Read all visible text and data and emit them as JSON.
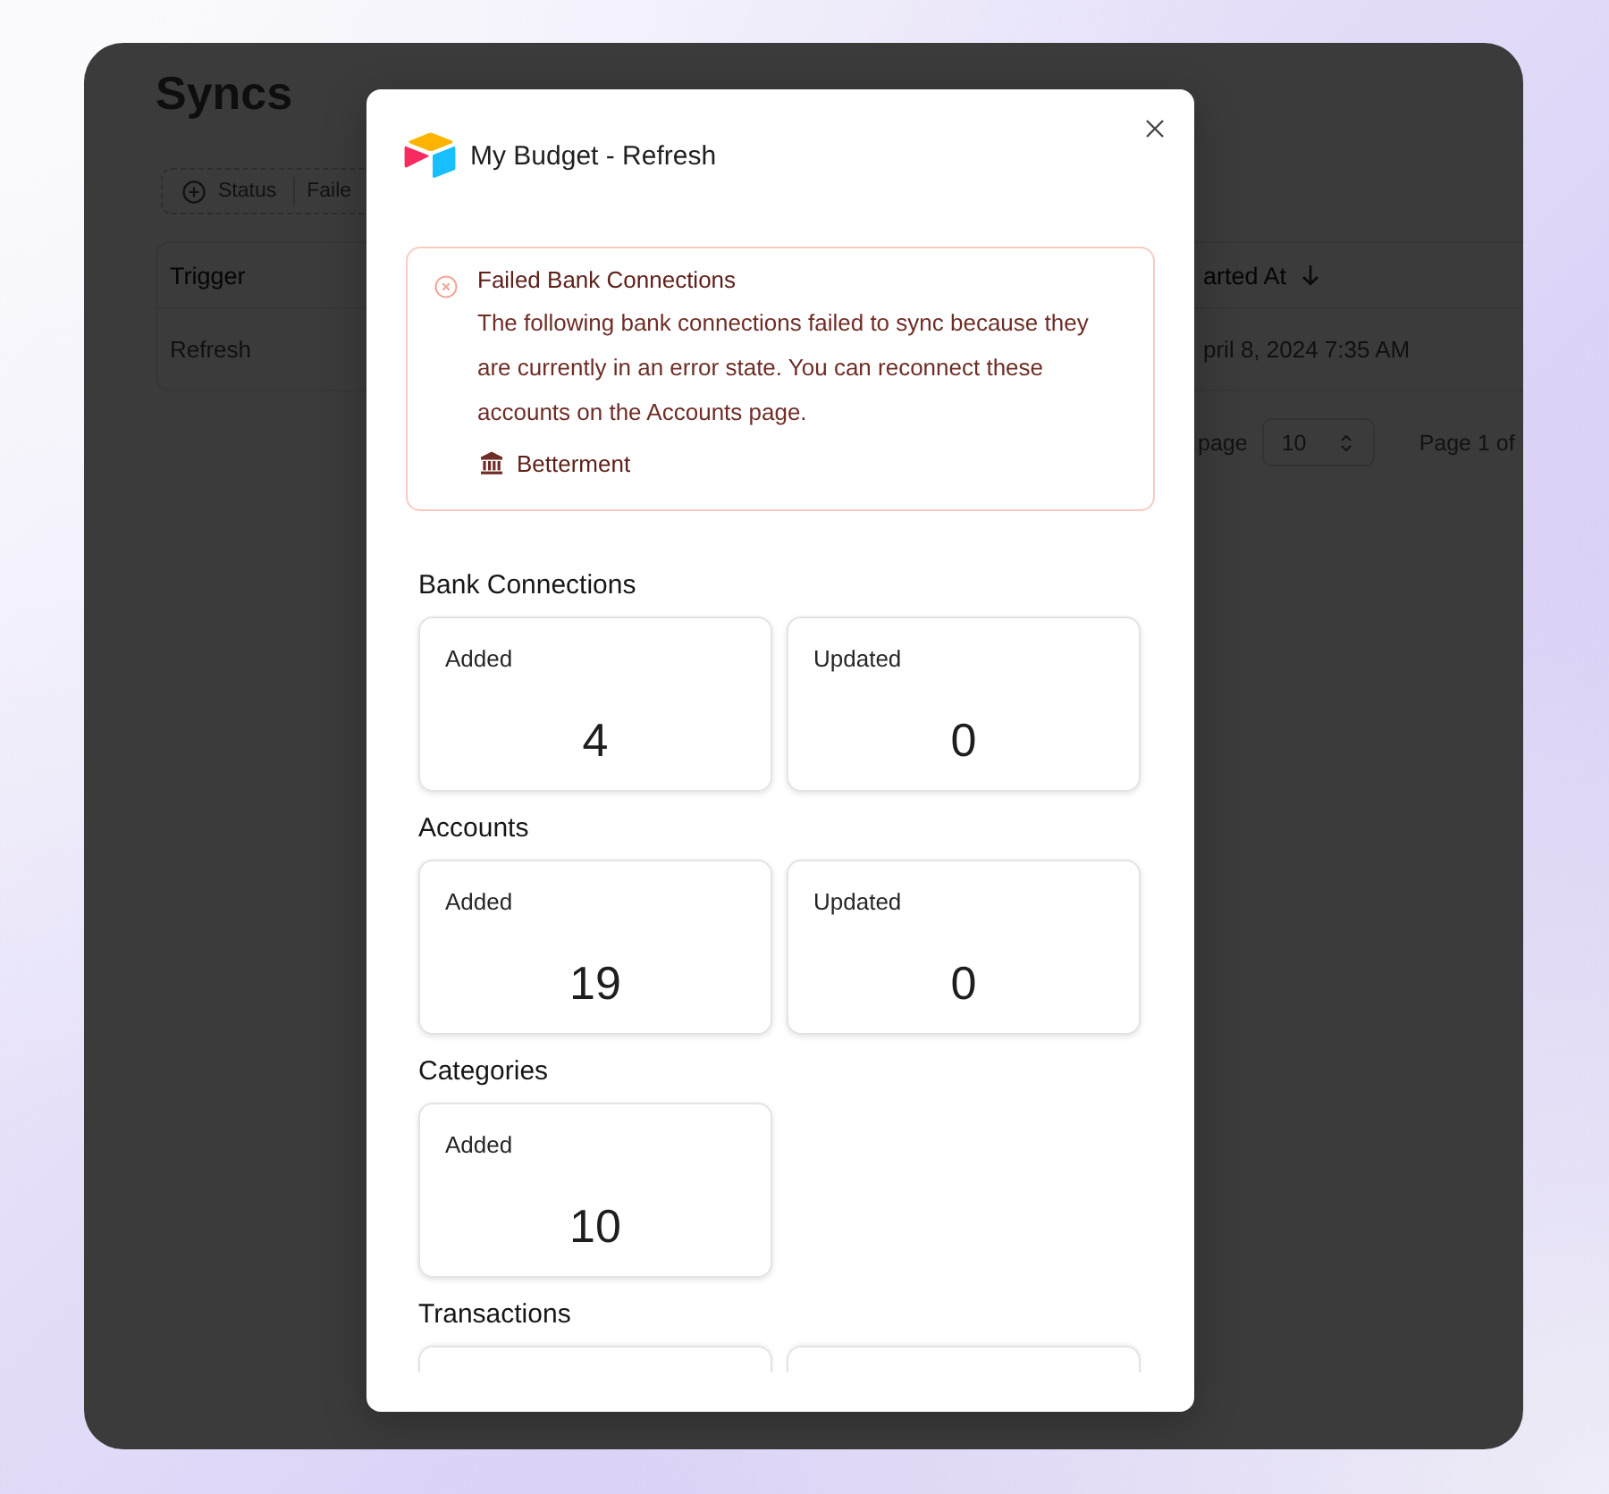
{
  "background_page": {
    "title": "Syncs",
    "filter": {
      "label": "Status",
      "value": "Faile"
    },
    "table": {
      "columns": [
        {
          "label": "Trigger",
          "sorted": false
        },
        {
          "label": "arted At",
          "sorted": true
        }
      ],
      "rows": [
        [
          "Refresh",
          "pril 8, 2024 7:35 AM"
        ]
      ]
    },
    "pagination": {
      "rows_label": "page",
      "page_size": "10",
      "page_info": "Page 1 of"
    }
  },
  "dialog": {
    "title": "My Budget - Refresh",
    "alert": {
      "title": "Failed Bank Connections",
      "message": "The following bank connections failed to sync because they are currently in an error state. You can reconnect these accounts on the Accounts page.",
      "items": [
        "Betterment"
      ]
    },
    "sections": [
      {
        "title": "Bank Connections",
        "cards": [
          {
            "kind": "stat",
            "label": "Added",
            "value": "4"
          },
          {
            "kind": "stat",
            "label": "Updated",
            "value": "0"
          }
        ]
      },
      {
        "title": "Accounts",
        "cards": [
          {
            "kind": "stat",
            "label": "Added",
            "value": "19"
          },
          {
            "kind": "stat",
            "label": "Updated",
            "value": "0"
          }
        ]
      },
      {
        "title": "Categories",
        "cards": [
          {
            "kind": "stat",
            "label": "Added",
            "value": "10"
          }
        ]
      },
      {
        "title": "Transactions",
        "cards": [
          {
            "kind": "clipped"
          },
          {
            "kind": "clipped"
          }
        ]
      }
    ]
  }
}
